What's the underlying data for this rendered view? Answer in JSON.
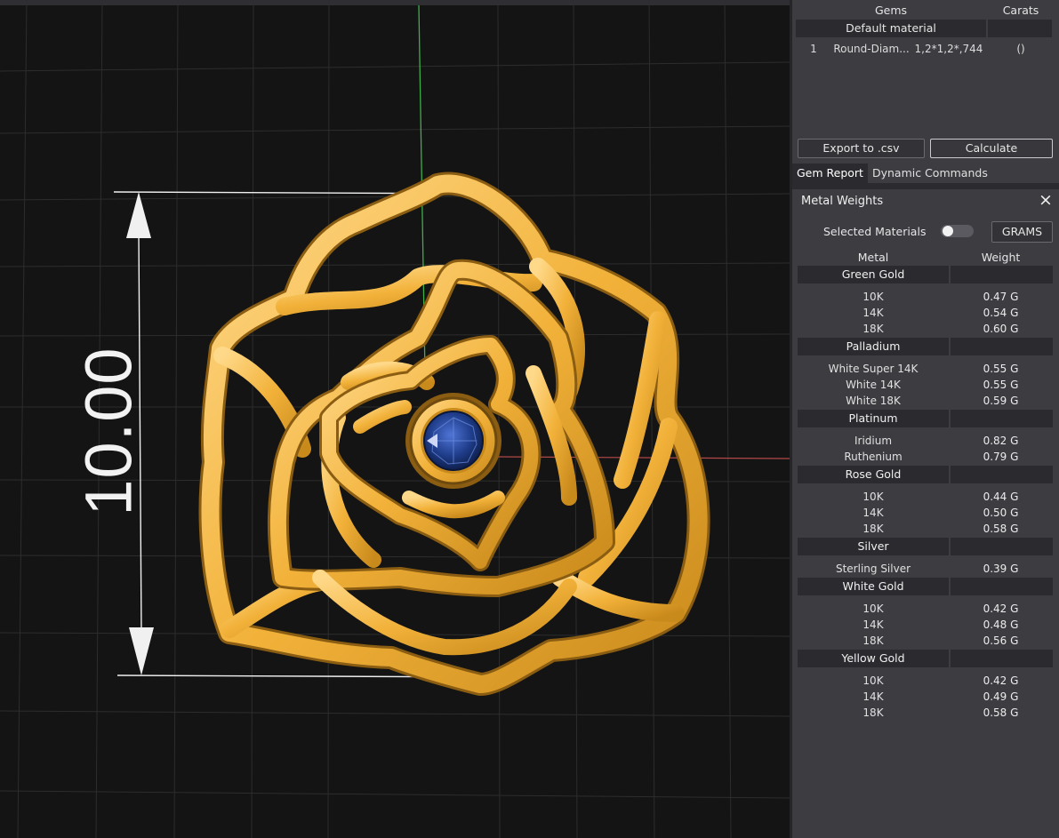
{
  "viewport": {
    "dimension_value": "10.00",
    "gem_color": "#1f3d8a",
    "metal_color": "#f2b23a"
  },
  "gems": {
    "columns": {
      "gems": "Gems",
      "carats": "Carats"
    },
    "group": "Default material",
    "rows": [
      {
        "index": "1",
        "name": "Round-Diam...",
        "size": "1,2*1,2*,744",
        "carats": "()"
      }
    ],
    "export_label": "Export to .csv",
    "calculate_label": "Calculate"
  },
  "tabs": [
    {
      "label": "Gem Report",
      "active": true
    },
    {
      "label": "Dynamic Commands",
      "active": false
    }
  ],
  "metal_weights": {
    "title": "Metal Weights",
    "close_icon": "×",
    "selected_materials_label": "Selected Materials",
    "unit_label": "GRAMS",
    "columns": {
      "metal": "Metal",
      "weight": "Weight"
    },
    "groups": [
      {
        "name": "Green Gold",
        "rows": [
          {
            "metal": "10K",
            "weight": "0.47 G"
          },
          {
            "metal": "14K",
            "weight": "0.54 G"
          },
          {
            "metal": "18K",
            "weight": "0.60 G"
          }
        ]
      },
      {
        "name": "Palladium",
        "rows": [
          {
            "metal": "White Super 14K",
            "weight": "0.55 G"
          },
          {
            "metal": "White 14K",
            "weight": "0.55 G"
          },
          {
            "metal": "White 18K",
            "weight": "0.59 G"
          }
        ]
      },
      {
        "name": "Platinum",
        "rows": [
          {
            "metal": "Iridium",
            "weight": "0.82 G"
          },
          {
            "metal": "Ruthenium",
            "weight": "0.79 G"
          }
        ]
      },
      {
        "name": "Rose Gold",
        "rows": [
          {
            "metal": "10K",
            "weight": "0.44 G"
          },
          {
            "metal": "14K",
            "weight": "0.50 G"
          },
          {
            "metal": "18K",
            "weight": "0.58 G"
          }
        ]
      },
      {
        "name": "Silver",
        "rows": [
          {
            "metal": "Sterling Silver",
            "weight": "0.39 G"
          }
        ]
      },
      {
        "name": "White Gold",
        "rows": [
          {
            "metal": "10K",
            "weight": "0.42 G"
          },
          {
            "metal": "14K",
            "weight": "0.48 G"
          },
          {
            "metal": "18K",
            "weight": "0.56 G"
          }
        ]
      },
      {
        "name": "Yellow Gold",
        "rows": [
          {
            "metal": "10K",
            "weight": "0.42 G"
          },
          {
            "metal": "14K",
            "weight": "0.49 G"
          },
          {
            "metal": "18K",
            "weight": "0.58 G"
          }
        ]
      }
    ]
  }
}
